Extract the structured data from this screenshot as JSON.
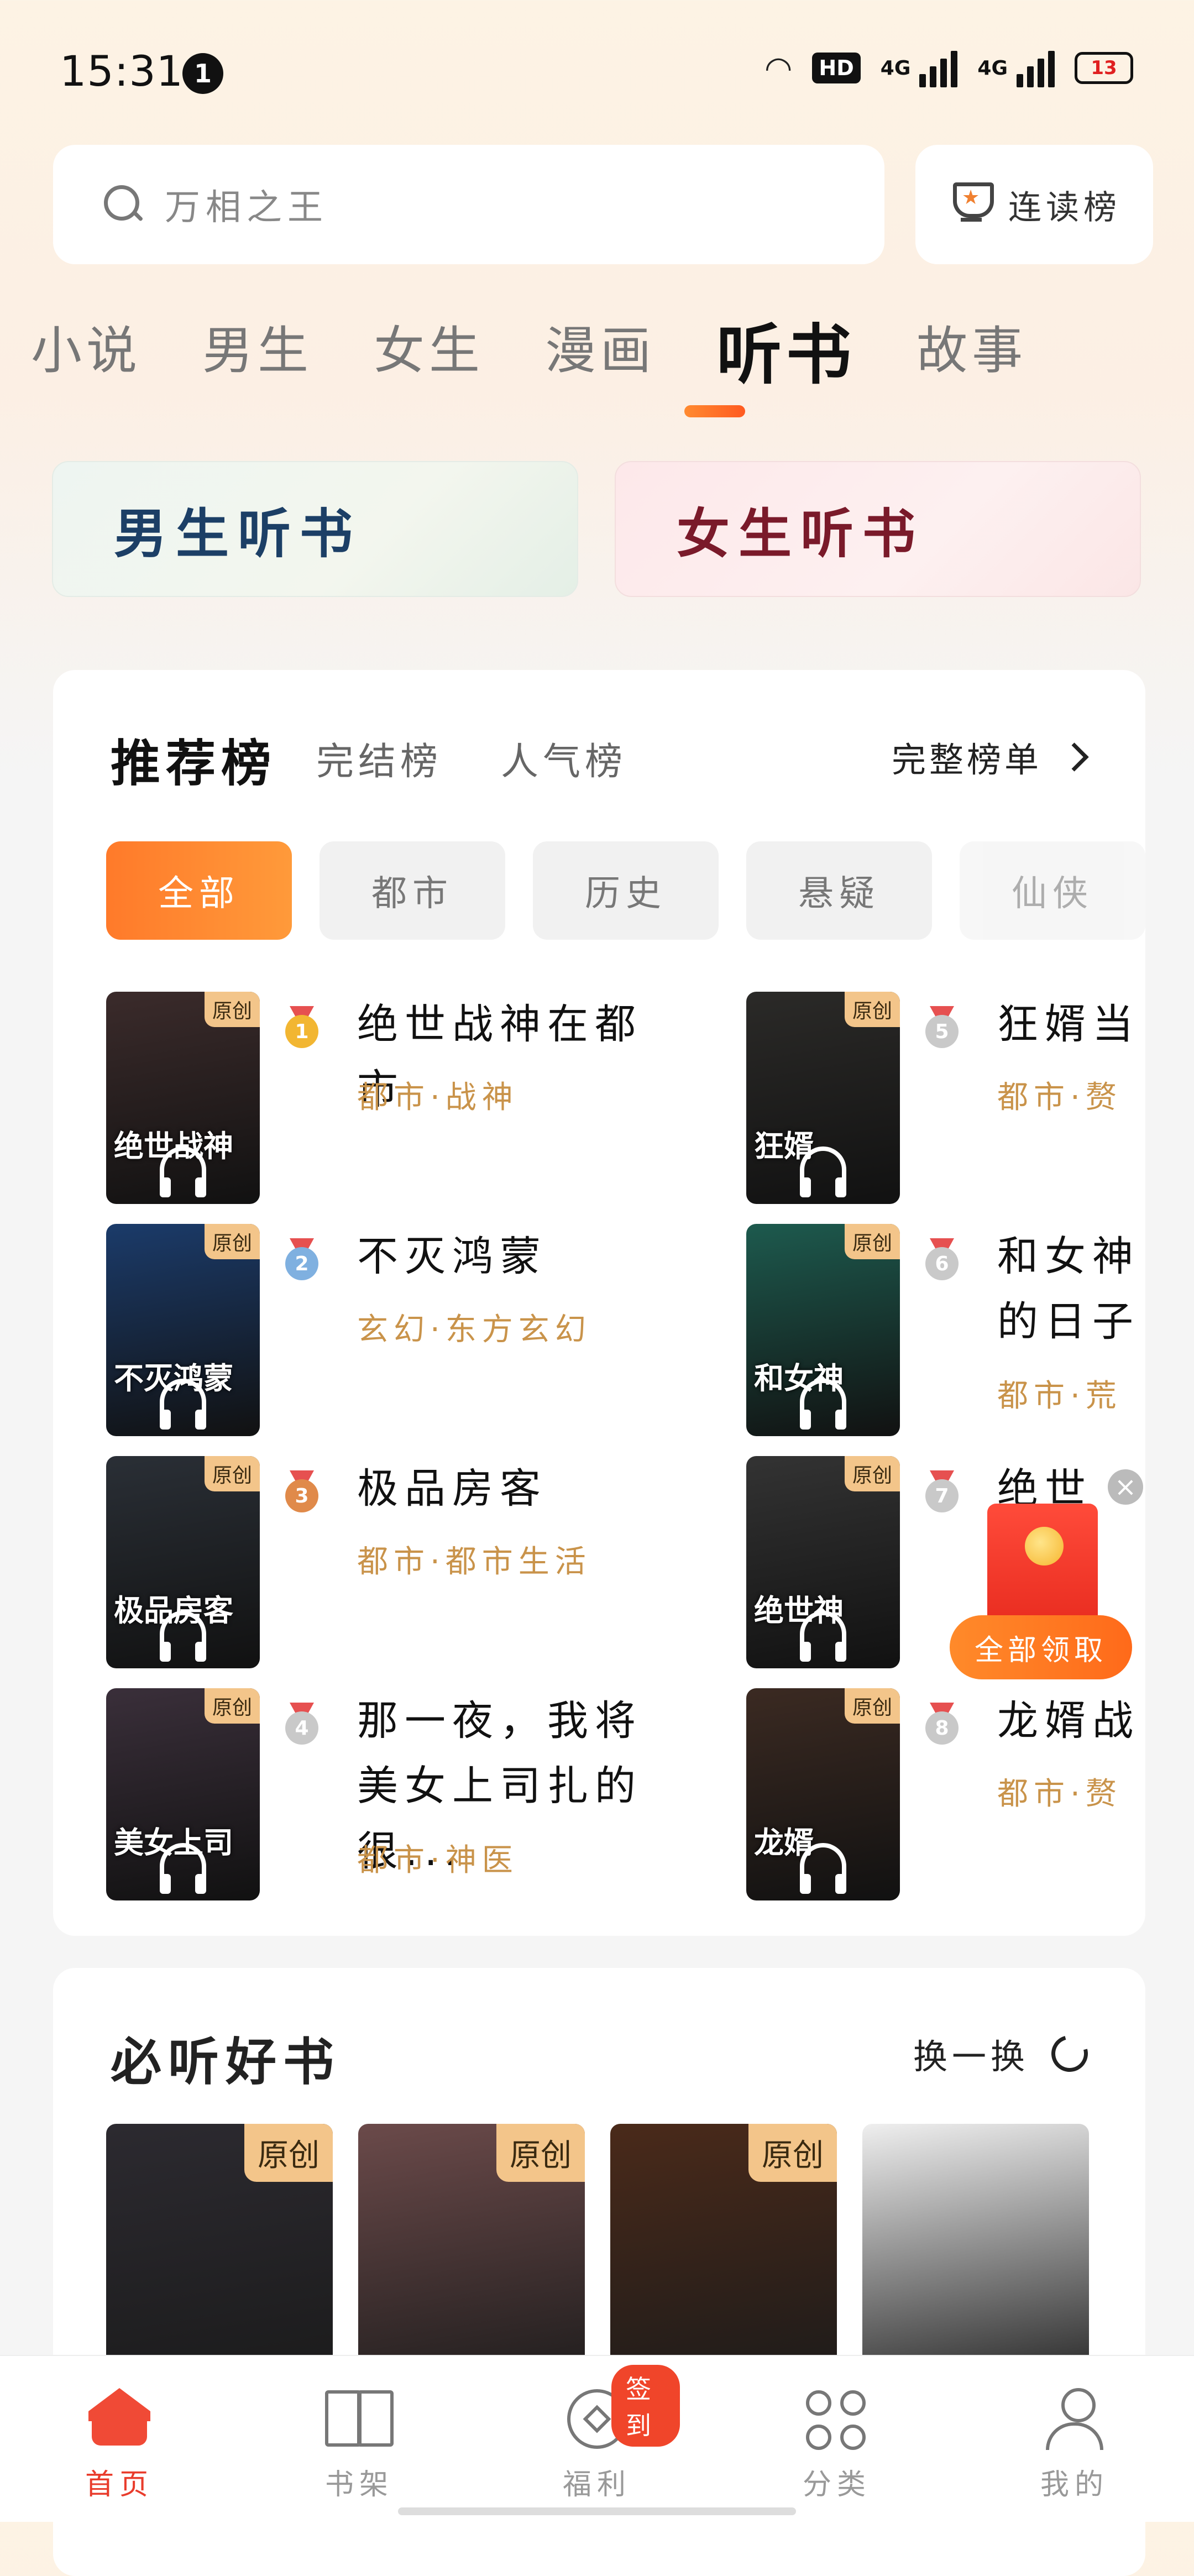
{
  "status": {
    "time": "15:31",
    "notification_count": "1",
    "hd_label": "HD",
    "net1": "4G",
    "net2": "4G",
    "battery": "13"
  },
  "search": {
    "placeholder": "万相之王"
  },
  "rank_button": {
    "label": "连读榜"
  },
  "tabs": [
    {
      "label": "小说"
    },
    {
      "label": "男生"
    },
    {
      "label": "女生"
    },
    {
      "label": "漫画"
    },
    {
      "label": "听书",
      "active": true
    },
    {
      "label": "故事"
    }
  ],
  "banners": {
    "male": "男生听书",
    "female": "女生听书"
  },
  "ranking": {
    "title": "推荐榜",
    "tabs": [
      "完结榜",
      "人气榜"
    ],
    "full_label": "完整榜单",
    "chips": [
      "全部",
      "都市",
      "历史",
      "悬疑",
      "仙侠"
    ],
    "original_tag": "原创",
    "books": [
      {
        "rank": "1",
        "title": "绝世战神在都市",
        "tags": "都市·战神",
        "cover_text": "绝世战神",
        "cover_color": "#3b2b2b",
        "medal_color": "#f2b632"
      },
      {
        "rank": "2",
        "title": "不灭鸿蒙",
        "tags": "玄幻·东方玄幻",
        "cover_text": "不灭鸿蒙",
        "cover_color": "#1b3b6a",
        "medal_color": "#7fb0e0"
      },
      {
        "rank": "3",
        "title": "极品房客",
        "tags": "都市·都市生活",
        "cover_text": "极品房客",
        "cover_color": "#2a2f36",
        "medal_color": "#e08a4a"
      },
      {
        "rank": "4",
        "title": "那一夜，我将美女上司扎的很...",
        "tags": "都市·神医",
        "cover_text": "美女上司",
        "cover_color": "#3a2f3a",
        "medal_color": "#c9c9c9"
      },
      {
        "rank": "5",
        "title": "狂婿当",
        "tags": "都市·赘",
        "cover_text": "狂婿",
        "cover_color": "#2b2a28",
        "medal_color": "#c9c9c9"
      },
      {
        "rank": "6",
        "title": "和女神",
        "title2": "的日子",
        "tags": "都市·荒",
        "cover_text": "和女神",
        "cover_color": "#1d5a4e",
        "medal_color": "#c9c9c9"
      },
      {
        "rank": "7",
        "title": "绝世",
        "tags": "都市",
        "cover_text": "绝世神",
        "cover_color": "#333333",
        "medal_color": "#c9c9c9"
      },
      {
        "rank": "8",
        "title": "龙婿战",
        "tags": "都市·赘",
        "cover_text": "龙婿",
        "cover_color": "#3b2a22",
        "medal_color": "#c9c9c9"
      }
    ]
  },
  "must_listen": {
    "title": "必听好书",
    "refresh_label": "换一换",
    "covers": [
      {
        "tag": "原创",
        "color": "#2c2a30"
      },
      {
        "tag": "原创",
        "color": "#6b4a4a"
      },
      {
        "tag": "原创",
        "color": "#4a2a1a"
      },
      {
        "tag": "",
        "color": "#efefef"
      }
    ]
  },
  "red_packet": {
    "label": "全部领取",
    "close": "×"
  },
  "bottom_nav": [
    {
      "label": "首页",
      "icon": "home-icon",
      "active": true
    },
    {
      "label": "书架",
      "icon": "bookshelf-icon"
    },
    {
      "label": "福利",
      "icon": "welfare-icon",
      "badge": "签到"
    },
    {
      "label": "分类",
      "icon": "category-icon"
    },
    {
      "label": "我的",
      "icon": "profile-icon"
    }
  ],
  "colors": {
    "accent": "#ff6a1a",
    "nav_active": "#e93c2c",
    "tag_gold": "#c9934a"
  }
}
